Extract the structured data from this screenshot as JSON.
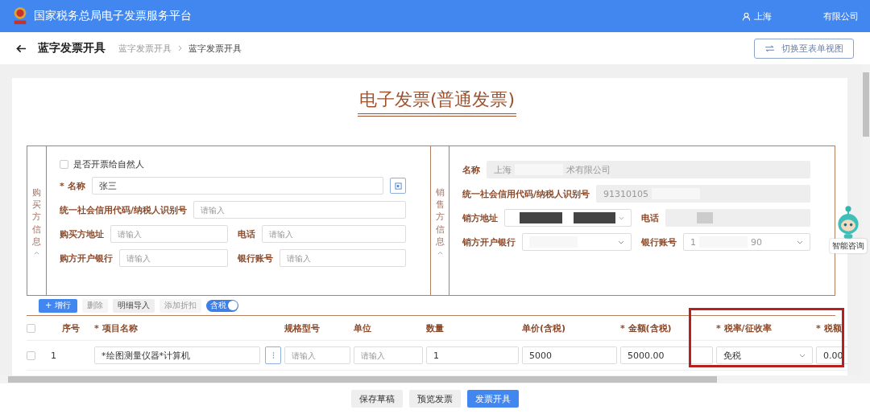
{
  "header": {
    "title": "国家税务总局电子发票服务平台",
    "user": "上海",
    "company": "有限公司"
  },
  "subheader": {
    "title": "蓝字发票开具",
    "breadcrumb": [
      {
        "label": "蓝字发票开具",
        "current": false
      },
      {
        "label": "蓝字发票开具",
        "current": true
      }
    ],
    "switch_button": "切换至表单视图"
  },
  "invoice_title": "电子发票(普通发票)",
  "buyer": {
    "section_label": "购买方信息",
    "natural_person": {
      "label": "是否开票给自然人",
      "checked": false
    },
    "rows": [
      [
        {
          "label": "* 名称",
          "kind": "input",
          "value": "张三",
          "picker": true
        }
      ],
      [
        {
          "label": "统一社会信用代码/纳税人识别号",
          "kind": "input",
          "placeholder": "请输入"
        }
      ],
      [
        {
          "label": "购买方地址",
          "kind": "input",
          "placeholder": "请输入"
        },
        {
          "label": "电话",
          "kind": "input",
          "placeholder": "请输入"
        }
      ],
      [
        {
          "label": "购方开户银行",
          "kind": "input",
          "placeholder": "请输入"
        },
        {
          "label": "银行账号",
          "kind": "input",
          "placeholder": "请输入"
        }
      ]
    ]
  },
  "seller": {
    "section_label": "销售方信息",
    "rows": [
      [
        {
          "label": "名称",
          "kind": "readonly",
          "parts": [
            {
              "kind": "text",
              "text": "上海"
            },
            {
              "kind": "blur-light"
            },
            {
              "kind": "text",
              "text": "术有限公司"
            }
          ]
        }
      ],
      [
        {
          "label": "统一社会信用代码/纳税人识别号",
          "kind": "readonly",
          "parts": [
            {
              "kind": "text",
              "text": "91310105"
            },
            {
              "kind": "blur-light"
            }
          ]
        }
      ],
      [
        {
          "label": "销方地址",
          "kind": "select",
          "parts": [
            {
              "kind": "blur-dark"
            },
            {
              "kind": "blur-dark"
            }
          ]
        },
        {
          "label": "电话",
          "kind": "readonly",
          "parts": [
            {
              "kind": "blur-grey"
            }
          ]
        }
      ],
      [
        {
          "label": "销方开户银行",
          "kind": "select",
          "parts": [
            {
              "kind": "blur-light"
            }
          ]
        },
        {
          "label": "银行账号",
          "kind": "select",
          "parts": [
            {
              "kind": "text",
              "text": "1"
            },
            {
              "kind": "blur-light"
            },
            {
              "kind": "text",
              "text": "90"
            }
          ]
        }
      ]
    ]
  },
  "toolbar": [
    {
      "label": "+ 增行",
      "kind": "primary"
    },
    {
      "label": "删除",
      "kind": "plain",
      "disabled": true
    },
    {
      "label": "明细导入",
      "kind": "plain",
      "disabled": false
    },
    {
      "label": "添加折扣",
      "kind": "plain",
      "disabled": true
    },
    {
      "label": "含税",
      "kind": "switch",
      "on": true
    }
  ],
  "table": {
    "select_all_checked": false,
    "columns": [
      {
        "label": "序号"
      },
      {
        "label": "* 项目名称"
      },
      {
        "label": "规格型号"
      },
      {
        "label": "单位"
      },
      {
        "label": "数量"
      },
      {
        "label": "单价(含税)"
      },
      {
        "label": "* 金额(含税)"
      },
      {
        "label": "* 税率/征收率"
      },
      {
        "label": "* 税额"
      }
    ],
    "rows": [
      {
        "checked": false,
        "cells": [
          {
            "kind": "text",
            "text": "1"
          },
          {
            "kind": "input",
            "value": "*绘图测量仪器*计算机",
            "more": true
          },
          {
            "kind": "input",
            "placeholder": "请输入"
          },
          {
            "kind": "input",
            "placeholder": "请输入"
          },
          {
            "kind": "input",
            "value": "1"
          },
          {
            "kind": "input",
            "value": "5000"
          },
          {
            "kind": "input",
            "value": "5000.00"
          },
          {
            "kind": "select",
            "value": "免税"
          },
          {
            "kind": "input",
            "value": "0.00"
          }
        ]
      }
    ]
  },
  "assistant": {
    "label": "智能咨询"
  },
  "footer": [
    {
      "label": "保存草稿",
      "kind": "plain"
    },
    {
      "label": "预览发票",
      "kind": "plain"
    },
    {
      "label": "发票开具",
      "kind": "primary"
    }
  ]
}
